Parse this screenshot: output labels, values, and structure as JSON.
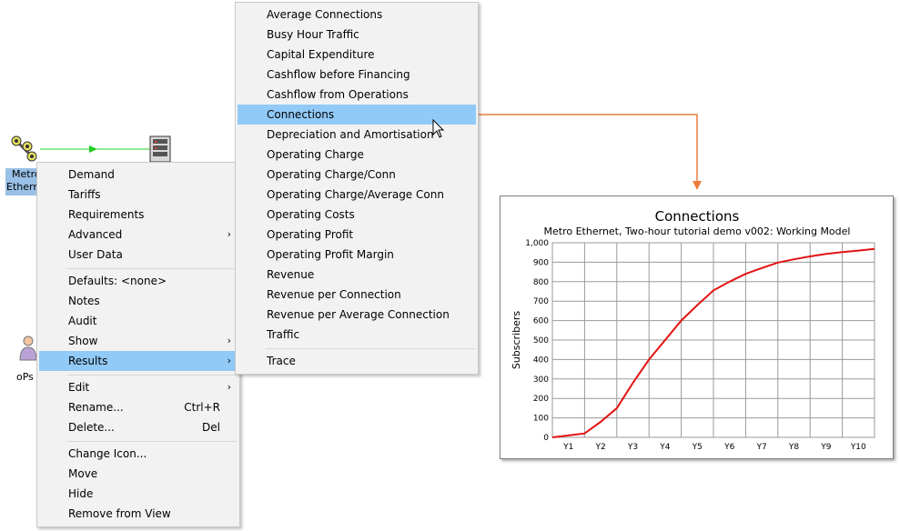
{
  "canvas": {
    "node1_label_line1": "Metro",
    "node1_label_line2": "Ethern",
    "node3_label_partial": "oPs"
  },
  "context_menu": {
    "items": [
      {
        "label": "Demand"
      },
      {
        "label": "Tariffs"
      },
      {
        "label": "Requirements"
      },
      {
        "label": "Advanced",
        "submenu": true
      },
      {
        "label": "User Data"
      },
      {
        "label": "Defaults: <none>"
      },
      {
        "label": "Notes"
      },
      {
        "label": "Audit"
      },
      {
        "label": "Show",
        "submenu": true
      },
      {
        "label": "Results",
        "submenu": true,
        "highlighted": true
      },
      {
        "label": "Edit",
        "submenu": true
      },
      {
        "label": "Rename...",
        "shortcut": "Ctrl+R"
      },
      {
        "label": "Delete...",
        "shortcut": "Del"
      },
      {
        "label": "Change Icon..."
      },
      {
        "label": "Move"
      },
      {
        "label": "Hide"
      },
      {
        "label": "Remove from View"
      }
    ],
    "submenu_arrow": "›"
  },
  "results_submenu": {
    "items": [
      {
        "label": "Average Connections"
      },
      {
        "label": "Busy Hour Traffic"
      },
      {
        "label": "Capital Expenditure"
      },
      {
        "label": "Cashflow before Financing"
      },
      {
        "label": "Cashflow from Operations"
      },
      {
        "label": "Connections",
        "highlighted": true
      },
      {
        "label": "Depreciation and Amortisation"
      },
      {
        "label": "Operating Charge"
      },
      {
        "label": "Operating Charge/Conn"
      },
      {
        "label": "Operating Charge/Average Conn"
      },
      {
        "label": "Operating Costs"
      },
      {
        "label": "Operating Profit"
      },
      {
        "label": "Operating Profit Margin"
      },
      {
        "label": "Revenue"
      },
      {
        "label": "Revenue per Connection"
      },
      {
        "label": "Revenue per Average Connection"
      },
      {
        "label": "Traffic"
      },
      {
        "label": "Trace"
      }
    ]
  },
  "colors": {
    "highlight": "#91c9f7",
    "callout_arrow": "#ee7d3b",
    "series_line": "#e31313",
    "link_line": "#22cc22"
  },
  "icons": [
    "node-router-icon",
    "node-rack-icon",
    "node-user-icon",
    "mouse-cursor-icon",
    "submenu-arrow-icon"
  ],
  "chart_data": {
    "type": "line",
    "title": "Connections",
    "subtitle": "Metro Ethernet, Two-hour tutorial demo v002: Working Model",
    "xlabel": "",
    "ylabel": "Subscribers",
    "categories": [
      "Y1",
      "Y2",
      "Y3",
      "Y4",
      "Y5",
      "Y6",
      "Y7",
      "Y8",
      "Y9",
      "Y10"
    ],
    "x": [
      0.5,
      1,
      1.5,
      2,
      2.5,
      3,
      3.5,
      4,
      4.5,
      5,
      5.5,
      6,
      6.5,
      7,
      7.5,
      8,
      8.5,
      9,
      9.5,
      10,
      10.5
    ],
    "series": [
      {
        "values": [
          0,
          10,
          20,
          80,
          150,
          280,
          400,
          500,
          600,
          680,
          755,
          800,
          840,
          870,
          898,
          915,
          930,
          943,
          952,
          960,
          968
        ]
      }
    ],
    "ylim": [
      0,
      1000
    ],
    "yticks": [
      "0",
      "100",
      "200",
      "300",
      "400",
      "500",
      "600",
      "700",
      "800",
      "900",
      "1,000"
    ],
    "grid": true,
    "legend": "none"
  }
}
